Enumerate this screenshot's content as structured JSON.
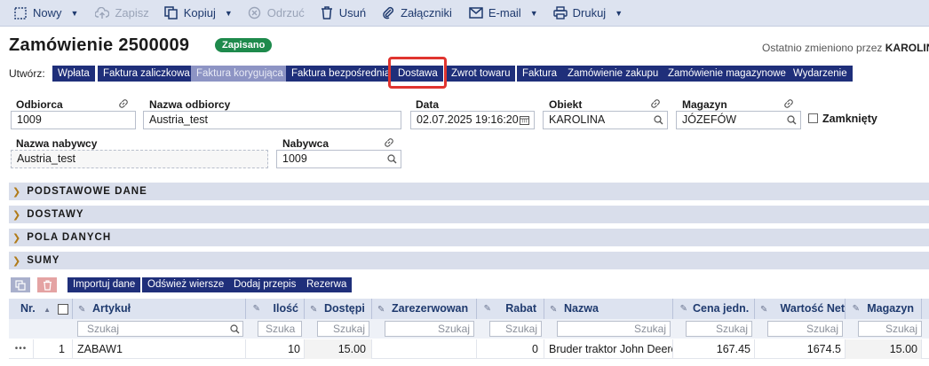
{
  "toolbar": {
    "new": "Nowy",
    "save": "Zapisz",
    "copy": "Kopiuj",
    "reject": "Odrzuć",
    "delete": "Usuń",
    "attachments": "Załączniki",
    "email": "E-mail",
    "print": "Drukuj"
  },
  "header": {
    "title": "Zamówienie 2500009",
    "status": "Zapisano",
    "last_changed_prefix": "Ostatnio zmieniono przez",
    "last_changed_user": "KAROLINA"
  },
  "create": {
    "label": "Utwórz:",
    "buttons": [
      "Wpłata",
      "Faktura zaliczkowa",
      "Faktura korygująca",
      "Faktura bezpośrednia",
      "Dostawa",
      "Zwrot towaru",
      "Faktura",
      "Zamówienie zakupu",
      "Zamówienie magazynowe",
      "Wydarzenie"
    ]
  },
  "fields": {
    "customer_label": "Odbiorca",
    "customer_value": "1009",
    "customer_name_label": "Nazwa odbiorcy",
    "customer_name_value": "Austria_test",
    "date_label": "Data",
    "date_value": "02.07.2025 19:16:20",
    "object_label": "Obiekt",
    "object_value": "KAROLINA",
    "warehouse_label": "Magazyn",
    "warehouse_value": "JÓZEFÓW",
    "closed_label": "Zamknięty",
    "buyer_name_label": "Nazwa nabywcy",
    "buyer_name_value": "Austria_test",
    "buyer_label": "Nabywca",
    "buyer_value": "1009"
  },
  "sections": [
    "PODSTAWOWE DANE",
    "DOSTAWY",
    "POLA DANYCH",
    "SUMY"
  ],
  "grid_buttons": [
    "Importuj dane",
    "Odśwież wiersze",
    "Dodaj przepis",
    "Rezerwa"
  ],
  "table": {
    "columns": [
      "Nr.",
      "Artykuł",
      "Ilość",
      "Dostępi",
      "Zarezerwowan",
      "Rabat",
      "Nazwa",
      "Cena jedn.",
      "Wartość Net",
      "Magazyn"
    ],
    "search_placeholder": "Szukaj",
    "search_placeholder_short": "Szuka",
    "rows": [
      {
        "menu": "•••",
        "nr": "1",
        "article": "ZABAW1",
        "qty": "10",
        "available": "15.00",
        "reserved": "",
        "discount": "0",
        "name": "Bruder traktor John Deere",
        "unit_price": "167.45",
        "net_value": "1674.5",
        "warehouse": "15.00"
      }
    ]
  }
}
